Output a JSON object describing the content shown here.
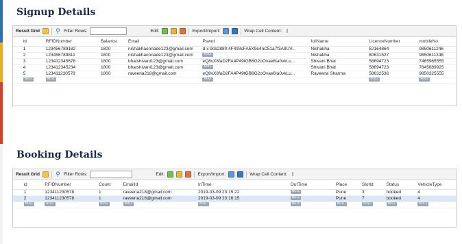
{
  "signup": {
    "title": "Signup Details",
    "toolbar": {
      "result_grid": "Result Grid",
      "filter_rows": "Filter Rows:",
      "edit": "Edit:",
      "export_import": "Export/Import:",
      "wrap_cell": "Wrap Cell Content:",
      "wrap_icon": "I"
    },
    "columns": [
      "id",
      "RFIDNumber",
      "Balance",
      "Email",
      "Pswrd",
      "fullName",
      "LicenceNumber",
      "mobileNo"
    ],
    "rows": [
      {
        "id": "1",
        "rfid": "123456789182",
        "balance": "1800",
        "email": "nishakhaonnade123@gmail.com",
        "pswd": "d-x 9cb2880:4F493cFA5X9e4nC51a7f3A8UV...",
        "name": "Nishakha",
        "licence": "52164864",
        "mobile": "9850611246"
      },
      {
        "id": "2",
        "rfid": "123456789811",
        "balance": "1800",
        "email": "nishakhaonnade123@gmail.com",
        "pswd": "",
        "name": "Nishakha",
        "licence": "80631527",
        "mobile": "9850611246"
      },
      {
        "id": "3",
        "rfid": "123412345678",
        "balance": "1800",
        "email": "bhatshivani123@gmail.com",
        "pswd": "eQ8vX8faD2FA4P49tGB6G2oOvae6Ia0vkLu...",
        "name": "Shivani Bhat",
        "licence": "58694723",
        "mobile": "7465965555"
      },
      {
        "id": "4",
        "rfid": "123412345234",
        "balance": "1800",
        "email": "bhatshivani123@gmail.com",
        "pswd": "",
        "name": "Shivani Bhat",
        "licence": "58694723",
        "mobile": "7845689925"
      },
      {
        "id": "5",
        "rfid": "123411230578",
        "balance": "1800",
        "email": "raveena218@gmail.com",
        "pswd": "eQ8vX8faD2FA4P49tGB6G2oOvae6Ia0vkLu...",
        "name": "Raveena Sharma",
        "licence": "58632536",
        "mobile": "9850325555"
      }
    ],
    "null_label": "NULL"
  },
  "booking": {
    "title": "Booking Details",
    "toolbar": {
      "result_grid": "Result Grid",
      "filter_rows": "Filter Rows:",
      "edit": "Edit:",
      "export_import": "Export/Import:",
      "wrap_cell": "Wrap Cell Content:",
      "wrap_icon": "I"
    },
    "columns": [
      "id",
      "RFIDNumber",
      "Count",
      "EmailId",
      "InTime",
      "OutTime",
      "Place",
      "SlotId",
      "Status",
      "VehicleType"
    ],
    "rows": [
      {
        "id": "1",
        "rfid": "123411230578",
        "count": "1",
        "email": "raveena218@gmail.com",
        "intime": "2019-03-09 23:15:22",
        "place": "Pune",
        "slot": "3",
        "status": "booked",
        "vtype": "4"
      },
      {
        "id": "2",
        "rfid": "123411230578",
        "count": "1",
        "email": "raveena218@gmail.com",
        "intime": "2019-03-09 23:16:15",
        "place": "Pune",
        "slot": "7",
        "status": "booked",
        "vtype": "4"
      }
    ],
    "null_label": "NULL"
  },
  "colors": {
    "title": "#1d2a4a",
    "toolbar_bg": "#f3f3f3",
    "selected_row": "#d9e8f8"
  }
}
